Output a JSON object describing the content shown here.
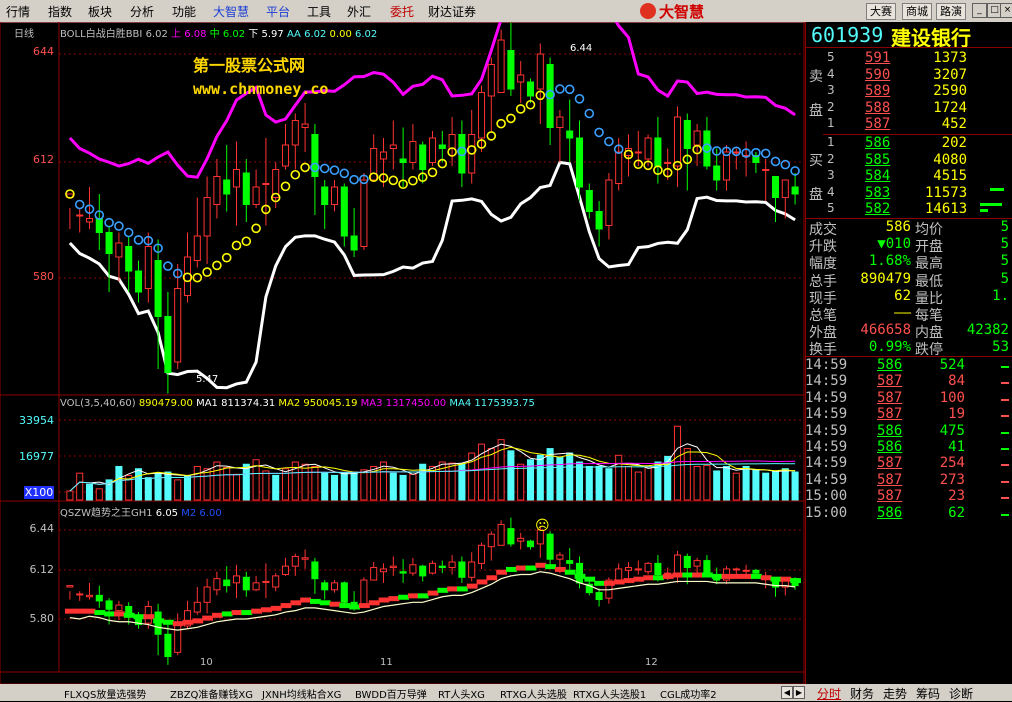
{
  "menu": [
    "行情",
    "指数",
    "板块",
    "分析",
    "功能",
    "大智慧",
    "平台",
    "工具",
    "外汇",
    "委托",
    "财达证券"
  ],
  "menu_styles": [
    "",
    "",
    "",
    "",
    "",
    "hl",
    "hl",
    "",
    "",
    "red",
    ""
  ],
  "logo_text": "大智慧",
  "top_buttons": [
    "大赛",
    "商城",
    "路演"
  ],
  "window_buttons": [
    "_",
    "□",
    "×"
  ],
  "period_label": "日线",
  "boll_legend": {
    "name": "BOLL白战白胜BBI",
    "v1": "6.02",
    "up_label": "上",
    "up": "6.08",
    "mid_label": "中",
    "mid": "6.02",
    "down_label": "下",
    "down": "5.97",
    "aa_label": "AA",
    "aa": "6.02",
    "v2": "0.00",
    "v3": "6.02"
  },
  "watermark": {
    "line1": "第一股票公式网",
    "line2": "www.chnmoney.co"
  },
  "price_axis": [
    "644",
    "612",
    "580"
  ],
  "high_mark": "6.44",
  "low_mark": "5.47",
  "vol_legend": {
    "name": "VOL(3,5,40,60)",
    "vol": "890479.00",
    "ma1_label": "MA1",
    "ma1": "811374.31",
    "ma2_label": "MA2",
    "ma2": "950045.19",
    "ma3_label": "MA3",
    "ma3": "1317450.00",
    "ma4_label": "MA4",
    "ma4": "1175393.75"
  },
  "vol_axis": [
    "33954",
    "16977",
    "X100"
  ],
  "qszw_legend": {
    "name": "QSZW趋势之王GH1",
    "gh1": "6.05",
    "m2_label": "M2",
    "m2": "6.00"
  },
  "qszw_axis": [
    "6.44",
    "6.12",
    "5.80"
  ],
  "smile_icon": "☹",
  "months": [
    "10",
    "11",
    "12"
  ],
  "bottom_tabs": [
    "FLXQS放量选强势",
    "ZBZQ准备赚钱XG",
    "JXNH均线粘合XG",
    "BWDD百万导弹",
    "RT人头XG",
    "RTXG人头选股",
    "RTXG人头选股1",
    "CGL成功率2"
  ],
  "right_tabs": [
    "分时",
    "财务",
    "走势",
    "筹码",
    "诊断"
  ],
  "stock": {
    "code": "601939",
    "name": "建设银行"
  },
  "sell_label": [
    "卖",
    "盘"
  ],
  "buy_label": [
    "买",
    "盘"
  ],
  "sell_orders": [
    {
      "n": "5",
      "price": "591",
      "vol": "1373"
    },
    {
      "n": "4",
      "price": "590",
      "vol": "3207"
    },
    {
      "n": "3",
      "price": "589",
      "vol": "2590"
    },
    {
      "n": "2",
      "price": "588",
      "vol": "1724"
    },
    {
      "n": "1",
      "price": "587",
      "vol": "452"
    }
  ],
  "buy_orders": [
    {
      "n": "1",
      "price": "586",
      "vol": "202"
    },
    {
      "n": "2",
      "price": "585",
      "vol": "4080"
    },
    {
      "n": "3",
      "price": "584",
      "vol": "4515"
    },
    {
      "n": "4",
      "price": "583",
      "vol": "11573"
    },
    {
      "n": "5",
      "price": "582",
      "vol": "14613"
    }
  ],
  "stats": [
    {
      "l1": "成交",
      "v1": "586",
      "l2": "均价",
      "v2": "5"
    },
    {
      "l1": "升跌",
      "v1": "▼010",
      "l2": "开盘",
      "v2": "5"
    },
    {
      "l1": "幅度",
      "v1": "1.68%",
      "l2": "最高",
      "v2": "5"
    },
    {
      "l1": "总手",
      "v1": "890479",
      "l2": "最低",
      "v2": "5"
    },
    {
      "l1": "现手",
      "v1": "62",
      "l2": "量比",
      "v2": "1."
    },
    {
      "l1": "总笔",
      "v1": "——",
      "l2": "每笔",
      "v2": ""
    },
    {
      "l1": "外盘",
      "v1": "466658",
      "l2": "内盘",
      "v2": "42382"
    },
    {
      "l1": "换手",
      "v1": "0.99%",
      "l2": "跌停",
      "v2": "53"
    }
  ],
  "ticks": [
    {
      "t": "14:59",
      "p": "586",
      "v": "524",
      "c": "g"
    },
    {
      "t": "14:59",
      "p": "587",
      "v": "84",
      "c": "r"
    },
    {
      "t": "14:59",
      "p": "587",
      "v": "100",
      "c": "r"
    },
    {
      "t": "14:59",
      "p": "587",
      "v": "19",
      "c": "r"
    },
    {
      "t": "14:59",
      "p": "586",
      "v": "475",
      "c": "g"
    },
    {
      "t": "14:59",
      "p": "586",
      "v": "41",
      "c": "g"
    },
    {
      "t": "14:59",
      "p": "587",
      "v": "254",
      "c": "r"
    },
    {
      "t": "14:59",
      "p": "587",
      "v": "273",
      "c": "r"
    },
    {
      "t": "15:00",
      "p": "587",
      "v": "23",
      "c": "r"
    },
    {
      "t": "15:00",
      "p": "586",
      "v": "62",
      "c": "g"
    }
  ],
  "colors": {
    "up": "#ff3232",
    "down": "#54fcfc",
    "green": "#00ff00",
    "boll_up": "#ff00ff",
    "boll_low": "#ffffff",
    "yellow": "#ffff00",
    "gold": "#ffd700"
  },
  "candles": [
    [
      6.03,
      6.04,
      6.0,
      5.94
    ],
    [
      5.98,
      5.98,
      6.0,
      5.93
    ],
    [
      5.96,
      5.97,
      6.06,
      5.94
    ],
    [
      5.97,
      5.93,
      6.04,
      5.88
    ],
    [
      5.93,
      5.87,
      5.95,
      5.76
    ],
    [
      5.86,
      5.9,
      5.93,
      5.79
    ],
    [
      5.89,
      5.82,
      5.92,
      5.76
    ],
    [
      5.82,
      5.76,
      5.85,
      5.73
    ],
    [
      5.77,
      5.89,
      5.93,
      5.73
    ],
    [
      5.85,
      5.69,
      5.91,
      5.54
    ],
    [
      5.69,
      5.53,
      5.76,
      5.47
    ],
    [
      5.56,
      5.77,
      5.84,
      5.54
    ],
    [
      5.75,
      5.86,
      5.93,
      5.73
    ],
    [
      5.85,
      5.92,
      6.03,
      5.83
    ],
    [
      5.92,
      6.03,
      6.09,
      5.84
    ],
    [
      6.01,
      6.09,
      6.14,
      5.97
    ],
    [
      6.08,
      6.04,
      6.18,
      5.99
    ],
    [
      6.06,
      6.11,
      6.19,
      5.95
    ],
    [
      6.1,
      6.01,
      6.14,
      5.96
    ],
    [
      6.01,
      6.06,
      6.11,
      6.0
    ],
    [
      6.07,
      6.07,
      6.2,
      5.95
    ],
    [
      6.03,
      6.11,
      6.13,
      6.0
    ],
    [
      6.12,
      6.18,
      6.24,
      6.11
    ],
    [
      6.18,
      6.25,
      6.27,
      6.11
    ],
    [
      6.23,
      6.24,
      6.3,
      6.16
    ],
    [
      6.21,
      6.09,
      6.24,
      5.98
    ],
    [
      6.06,
      6.01,
      6.08,
      5.94
    ],
    [
      6.01,
      6.06,
      6.08,
      5.99
    ],
    [
      6.06,
      5.92,
      6.07,
      5.89
    ],
    [
      5.92,
      5.88,
      6.0,
      5.86
    ],
    [
      5.89,
      6.08,
      6.1,
      5.88
    ],
    [
      6.08,
      6.17,
      6.21,
      6.08
    ],
    [
      6.14,
      6.16,
      6.2,
      6.06
    ],
    [
      6.17,
      6.18,
      6.25,
      6.11
    ],
    [
      6.14,
      6.13,
      6.23,
      6.06
    ],
    [
      6.13,
      6.19,
      6.24,
      6.11
    ],
    [
      6.18,
      6.11,
      6.19,
      6.07
    ],
    [
      6.13,
      6.2,
      6.22,
      6.12
    ],
    [
      6.18,
      6.17,
      6.22,
      6.13
    ],
    [
      6.17,
      6.21,
      6.26,
      6.12
    ],
    [
      6.21,
      6.1,
      6.25,
      6.06
    ],
    [
      6.1,
      6.21,
      6.28,
      6.07
    ],
    [
      6.2,
      6.33,
      6.35,
      6.16
    ],
    [
      6.32,
      6.41,
      6.43,
      6.22
    ],
    [
      6.33,
      6.48,
      6.51,
      6.33
    ],
    [
      6.45,
      6.34,
      6.53,
      6.32
    ],
    [
      6.36,
      6.38,
      6.42,
      6.3
    ],
    [
      6.36,
      6.32,
      6.37,
      6.3
    ],
    [
      6.34,
      6.44,
      6.47,
      6.24
    ],
    [
      6.41,
      6.23,
      6.43,
      6.18
    ],
    [
      6.23,
      6.26,
      6.28,
      6.13
    ],
    [
      6.22,
      6.2,
      6.31,
      6.13
    ],
    [
      6.2,
      6.06,
      6.25,
      6.02
    ],
    [
      6.05,
      5.99,
      6.07,
      5.97
    ],
    [
      5.99,
      5.94,
      6.02,
      5.89
    ],
    [
      5.95,
      6.08,
      6.1,
      5.91
    ],
    [
      6.07,
      6.16,
      6.2,
      6.05
    ],
    [
      6.15,
      6.17,
      6.21,
      6.09
    ],
    [
      6.16,
      6.16,
      6.22,
      6.12
    ],
    [
      6.14,
      6.2,
      6.21,
      6.12
    ],
    [
      6.2,
      6.12,
      6.26,
      6.07
    ],
    [
      6.13,
      6.13,
      6.17,
      6.08
    ],
    [
      6.12,
      6.26,
      6.29,
      6.06
    ],
    [
      6.25,
      6.17,
      6.27,
      6.05
    ],
    [
      6.18,
      6.22,
      6.24,
      6.12
    ],
    [
      6.22,
      6.12,
      6.26,
      6.11
    ],
    [
      6.12,
      6.08,
      6.17,
      6.05
    ],
    [
      6.08,
      6.16,
      6.18,
      6.05
    ],
    [
      6.16,
      6.16,
      6.17,
      6.11
    ],
    [
      6.15,
      6.15,
      6.19,
      6.09
    ],
    [
      6.15,
      6.13,
      6.16,
      6.1
    ],
    [
      6.11,
      6.11,
      6.14,
      6.02
    ],
    [
      6.09,
      6.03,
      6.09,
      5.96
    ],
    [
      6.03,
      6.08,
      6.08,
      5.97
    ],
    [
      6.06,
      6.04,
      6.1,
      6.01
    ]
  ],
  "volume": [
    [
      40,
      0
    ],
    [
      120,
      0
    ],
    [
      70,
      1
    ],
    [
      50,
      0
    ],
    [
      90,
      1
    ],
    [
      150,
      1
    ],
    [
      110,
      0
    ],
    [
      140,
      1
    ],
    [
      100,
      1
    ],
    [
      120,
      1
    ],
    [
      125,
      1
    ],
    [
      90,
      0
    ],
    [
      110,
      1
    ],
    [
      150,
      0
    ],
    [
      140,
      0
    ],
    [
      170,
      0
    ],
    [
      145,
      0
    ],
    [
      115,
      0
    ],
    [
      160,
      1
    ],
    [
      180,
      0
    ],
    [
      130,
      0
    ],
    [
      110,
      1
    ],
    [
      140,
      0
    ],
    [
      170,
      0
    ],
    [
      160,
      0
    ],
    [
      150,
      0
    ],
    [
      120,
      1
    ],
    [
      110,
      1
    ],
    [
      120,
      1
    ],
    [
      125,
      1
    ],
    [
      135,
      0
    ],
    [
      150,
      0
    ],
    [
      170,
      0
    ],
    [
      120,
      1
    ],
    [
      110,
      1
    ],
    [
      115,
      0
    ],
    [
      160,
      1
    ],
    [
      150,
      0
    ],
    [
      170,
      0
    ],
    [
      165,
      0
    ],
    [
      160,
      1
    ],
    [
      210,
      0
    ],
    [
      250,
      0
    ],
    [
      230,
      0
    ],
    [
      270,
      0
    ],
    [
      220,
      1
    ],
    [
      160,
      0
    ],
    [
      180,
      1
    ],
    [
      200,
      1
    ],
    [
      230,
      1
    ],
    [
      190,
      1
    ],
    [
      210,
      1
    ],
    [
      170,
      1
    ],
    [
      150,
      1
    ],
    [
      150,
      1
    ],
    [
      140,
      1
    ],
    [
      200,
      0
    ],
    [
      150,
      0
    ],
    [
      125,
      0
    ],
    [
      150,
      0
    ],
    [
      170,
      1
    ],
    [
      195,
      1
    ],
    [
      330,
      0
    ],
    [
      230,
      0
    ],
    [
      150,
      0
    ],
    [
      155,
      0
    ],
    [
      130,
      1
    ],
    [
      150,
      1
    ],
    [
      120,
      0
    ],
    [
      150,
      1
    ],
    [
      135,
      1
    ],
    [
      120,
      1
    ],
    [
      130,
      1
    ],
    [
      140,
      1
    ],
    [
      125,
      1
    ]
  ],
  "qszw": [
    [
      5.85,
      5.86
    ],
    [
      5.84,
      5.86
    ],
    [
      5.86,
      5.86
    ],
    [
      5.85,
      5.84
    ],
    [
      5.83,
      5.84
    ],
    [
      5.82,
      5.84
    ],
    [
      5.82,
      5.83
    ],
    [
      5.81,
      5.82
    ],
    [
      5.8,
      5.82
    ],
    [
      5.78,
      5.79
    ],
    [
      5.77,
      5.78
    ],
    [
      5.76,
      5.77
    ],
    [
      5.77,
      5.78
    ],
    [
      5.78,
      5.79
    ],
    [
      5.8,
      5.81
    ],
    [
      5.82,
      5.83
    ],
    [
      5.83,
      5.84
    ],
    [
      5.84,
      5.85
    ],
    [
      5.84,
      5.85
    ],
    [
      5.85,
      5.86
    ],
    [
      5.86,
      5.87
    ],
    [
      5.87,
      5.88
    ],
    [
      5.89,
      5.9
    ],
    [
      5.9,
      5.92
    ],
    [
      5.92,
      5.94
    ],
    [
      5.92,
      5.93
    ],
    [
      5.91,
      5.92
    ],
    [
      5.9,
      5.91
    ],
    [
      5.89,
      5.9
    ],
    [
      5.88,
      5.89
    ],
    [
      5.89,
      5.9
    ],
    [
      5.91,
      5.92
    ],
    [
      5.93,
      5.94
    ],
    [
      5.94,
      5.95
    ],
    [
      5.95,
      5.96
    ],
    [
      5.96,
      5.97
    ],
    [
      5.96,
      5.97
    ],
    [
      5.98,
      5.99
    ],
    [
      6.0,
      6.01
    ],
    [
      6.01,
      6.02
    ],
    [
      6.01,
      6.02
    ],
    [
      6.03,
      6.04
    ],
    [
      6.06,
      6.07
    ],
    [
      6.09,
      6.1
    ],
    [
      6.13,
      6.14
    ],
    [
      6.15,
      6.16
    ],
    [
      6.16,
      6.17
    ],
    [
      6.16,
      6.17
    ],
    [
      6.18,
      6.19
    ],
    [
      6.17,
      6.18
    ],
    [
      6.15,
      6.16
    ],
    [
      6.13,
      6.14
    ],
    [
      6.1,
      6.11
    ],
    [
      6.08,
      6.09
    ],
    [
      6.05,
      6.06
    ],
    [
      6.05,
      6.06
    ],
    [
      6.06,
      6.07
    ],
    [
      6.07,
      6.08
    ],
    [
      6.08,
      6.09
    ],
    [
      6.09,
      6.1
    ],
    [
      6.09,
      6.1
    ],
    [
      6.1,
      6.11
    ],
    [
      6.11,
      6.12
    ],
    [
      6.11,
      6.12
    ],
    [
      6.11,
      6.12
    ],
    [
      6.11,
      6.12
    ],
    [
      6.1,
      6.11
    ],
    [
      6.1,
      6.11
    ],
    [
      6.1,
      6.11
    ],
    [
      6.1,
      6.11
    ],
    [
      6.1,
      6.11
    ],
    [
      6.09,
      6.1
    ],
    [
      6.08,
      6.09
    ],
    [
      6.08,
      6.09
    ],
    [
      6.07,
      6.08
    ]
  ]
}
